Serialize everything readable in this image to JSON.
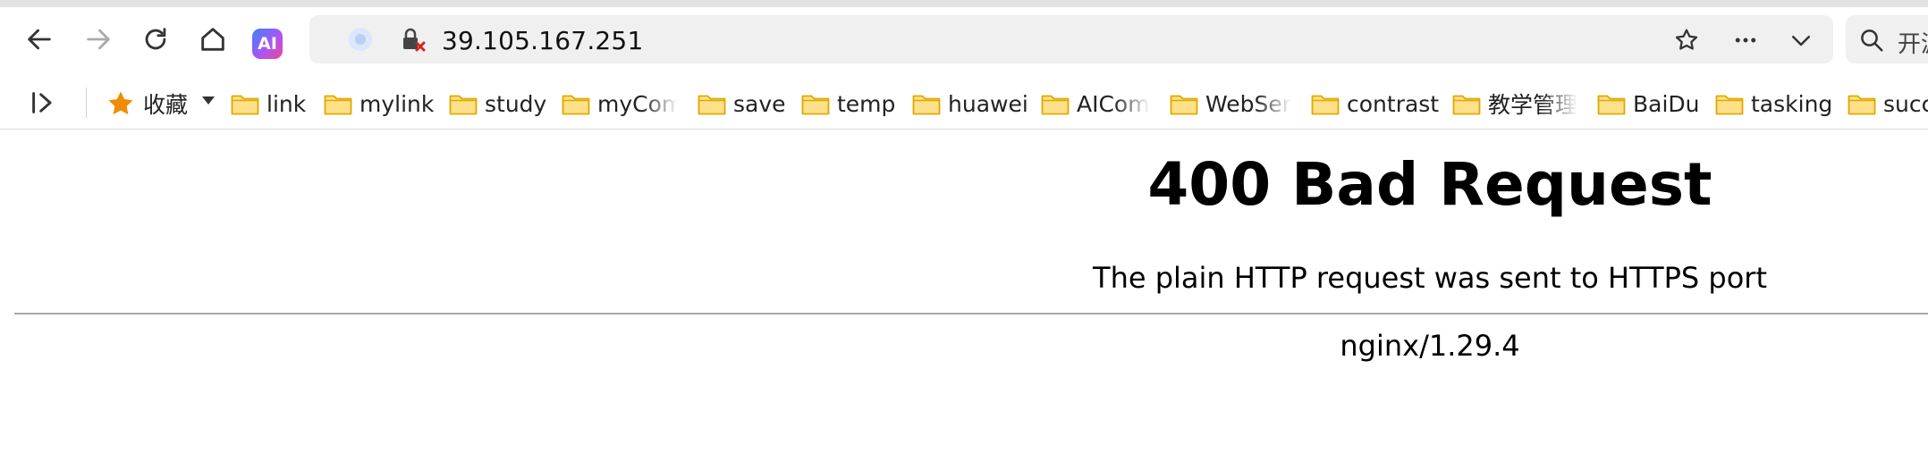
{
  "browser": {
    "address_bar": {
      "url": "39.105.167.251"
    },
    "ai_badge": "AI",
    "search_box": {
      "label": "开源"
    }
  },
  "bookmarks": [
    {
      "label": "收藏",
      "icon": "star-icon"
    },
    {
      "label": "link",
      "icon": "folder-icon"
    },
    {
      "label": "mylink",
      "icon": "folder-icon"
    },
    {
      "label": "study",
      "icon": "folder-icon"
    },
    {
      "label": "myCom",
      "icon": "folder-icon"
    },
    {
      "label": "save",
      "icon": "folder-icon"
    },
    {
      "label": "temp",
      "icon": "folder-icon"
    },
    {
      "label": "huawei",
      "icon": "folder-icon"
    },
    {
      "label": "AICom",
      "icon": "folder-icon"
    },
    {
      "label": "WebSer",
      "icon": "folder-icon"
    },
    {
      "label": "contrast",
      "icon": "folder-icon"
    },
    {
      "label": "教学管理",
      "icon": "folder-icon"
    },
    {
      "label": "BaiDu",
      "icon": "folder-icon"
    },
    {
      "label": "tasking",
      "icon": "folder-icon"
    },
    {
      "label": "succ",
      "icon": "folder-icon"
    }
  ],
  "page": {
    "heading": "400 Bad Request",
    "message": "The plain HTTP request was sent to HTTPS port",
    "server": "nginx/1.29.4"
  },
  "colors": {
    "star": "#f08c00",
    "folder_fill": "#ffe18a",
    "folder_stroke": "#e0a800",
    "lock_badge": "#e02020"
  }
}
